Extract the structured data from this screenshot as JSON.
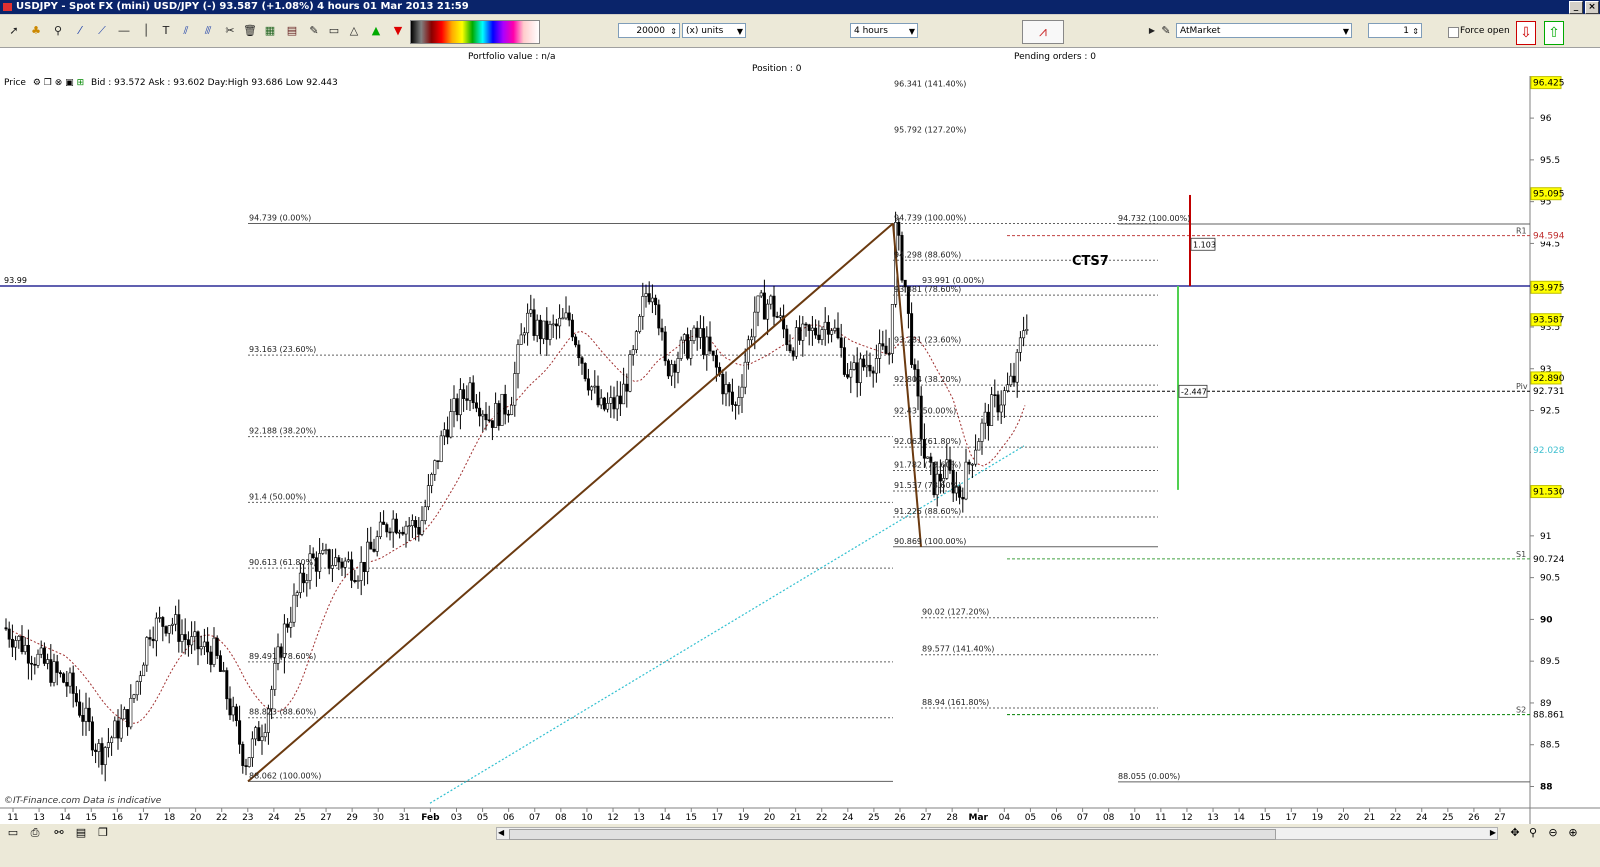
{
  "window": {
    "title": "USDJPY - Spot FX (mini) USD/JPY (-)    93.587 (+1.08%)    4 hours  01 Mar 2013 21:59"
  },
  "toolbar": {
    "quantity": "20000",
    "units": "(x) units",
    "timeframe": "4 hours",
    "order_type": "AtMarket",
    "order_count": "1",
    "force_open": "Force open"
  },
  "info": {
    "portfolio_value": "Portfolio value : n/a",
    "pending_orders": "Pending orders : 0",
    "position": "Position : 0"
  },
  "price_header": {
    "label": "Price",
    "quote": "Bid : 93.572  Ask : 93.602  Day:High 93.686  Low 92.443"
  },
  "chart_data": {
    "type": "candlestick",
    "symbol": "USDJPY",
    "watermark": "©IT-Finance.com   Data is indicative",
    "ylim": [
      87.5,
      96.6
    ],
    "xlim": [
      0,
      1530
    ],
    "y_ticks": [
      "88",
      "88.5",
      "89",
      "89.5",
      "90",
      "90.5",
      "91",
      "91.5",
      "92",
      "92.5",
      "93",
      "93.5",
      "94",
      "94.5",
      "95",
      "95.5",
      "96"
    ],
    "x_ticks": [
      "11",
      "13",
      "14",
      "15",
      "16",
      "17",
      "18",
      "20",
      "22",
      "23",
      "24",
      "25",
      "27",
      "29",
      "30",
      "31",
      "Feb",
      "03",
      "05",
      "06",
      "07",
      "08",
      "10",
      "12",
      "13",
      "14",
      "15",
      "17",
      "19",
      "20",
      "21",
      "22",
      "24",
      "25",
      "26",
      "27",
      "28",
      "Mar",
      "04",
      "05",
      "06",
      "07",
      "08",
      "10",
      "11",
      "12",
      "13",
      "14",
      "15",
      "17",
      "19",
      "20",
      "21",
      "22",
      "24",
      "25",
      "26",
      "27"
    ],
    "price_tags": [
      {
        "value": "96.425",
        "y": 96.425,
        "color": "#ffff00"
      },
      {
        "value": "95.095",
        "y": 95.095,
        "color": "#ffff00"
      },
      {
        "value": "94.594",
        "y": 94.594,
        "color": "#ffffff",
        "label": "R1"
      },
      {
        "value": "93.975",
        "y": 93.975,
        "color": "#ffff00"
      },
      {
        "value": "93.587",
        "y": 93.587,
        "color": "#ffff00"
      },
      {
        "value": "92.890",
        "y": 92.89,
        "color": "#ffff00"
      },
      {
        "value": "92.731",
        "y": 92.731,
        "color": "#ffffff",
        "label": "Piv"
      },
      {
        "value": "92.028",
        "y": 92.028,
        "color": "#ffffff"
      },
      {
        "value": "91.530",
        "y": 91.53,
        "color": "#ffff00"
      },
      {
        "value": "90.724",
        "y": 90.724,
        "color": "#ffffff",
        "label": "S1"
      },
      {
        "value": "88.861",
        "y": 88.861,
        "color": "#ffffff",
        "label": "S2"
      }
    ],
    "horizontal_lines": [
      {
        "y": 93.99,
        "label": "93.99",
        "color": "#000080"
      }
    ],
    "fib_retracement_1": {
      "levels": [
        {
          "y": 94.739,
          "label": "94.739 (0.00%)"
        },
        {
          "y": 93.163,
          "label": "93.163 (23.60%)"
        },
        {
          "y": 92.188,
          "label": "92.188 (38.20%)"
        },
        {
          "y": 91.4,
          "label": "91.4 (50.00%)"
        },
        {
          "y": 90.613,
          "label": "90.613 (61.80%)"
        },
        {
          "y": 89.491,
          "label": "89.491 (78.60%)"
        },
        {
          "y": 88.823,
          "label": "88.823 (88.60%)"
        },
        {
          "y": 88.062,
          "label": "88.062 (100.00%)"
        }
      ]
    },
    "fib_retracement_2": {
      "levels": [
        {
          "y": 96.341,
          "label": "96.341 (141.40%)"
        },
        {
          "y": 95.792,
          "label": "95.792 (127.20%)"
        },
        {
          "y": 94.739,
          "label": "94.739 (100.00%)"
        },
        {
          "y": 94.298,
          "label": "94.298 (88.60%)"
        },
        {
          "y": 93.991,
          "label": "93.991 (0.00%)"
        },
        {
          "y": 93.881,
          "label": "93.881 (78.60%)"
        },
        {
          "y": 93.281,
          "label": "93.281 (23.60%)"
        },
        {
          "y": 92.804,
          "label": "92.804 (38.20%)"
        },
        {
          "y": 92.43,
          "label": "92.43 (50.00%)"
        },
        {
          "y": 92.062,
          "label": "92.062 (61.80%)"
        },
        {
          "y": 91.782,
          "label": "91.782 (78.60%)"
        },
        {
          "y": 91.537,
          "label": "91.537 (78.60%)"
        },
        {
          "y": 91.225,
          "label": "91.225 (88.60%)"
        },
        {
          "y": 90.869,
          "label": "90.869 (100.00%)"
        },
        {
          "y": 90.02,
          "label": "90.02 (127.20%)"
        },
        {
          "y": 89.577,
          "label": "89.577 (141.40%)"
        },
        {
          "y": 88.94,
          "label": "88.94 (161.80%)"
        }
      ]
    },
    "projection_labels": [
      {
        "y": 94.732,
        "label": "94.732 (100.00%)"
      },
      {
        "y": 88.055,
        "label": "88.055 (0.00%)"
      }
    ],
    "annotations": [
      {
        "text": "CTS7"
      },
      {
        "text": "1.103"
      },
      {
        "text": "-2.447"
      }
    ]
  }
}
